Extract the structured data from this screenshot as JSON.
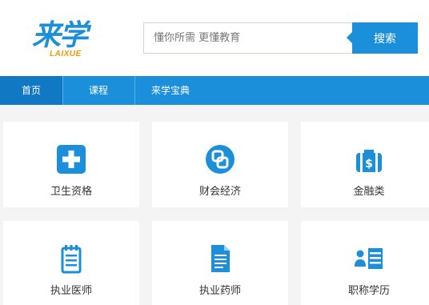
{
  "logo": {
    "main": "来学",
    "sub": "LAIXUE"
  },
  "search": {
    "placeholder": "懂你所需 更懂教育",
    "value": "",
    "button_label": "搜索"
  },
  "nav": {
    "items": [
      "首页",
      "课程",
      "来学宝典"
    ]
  },
  "categories": [
    {
      "label": "卫生资格",
      "icon": "medical-cross-icon"
    },
    {
      "label": "财会经济",
      "icon": "coins-icon"
    },
    {
      "label": "金融类",
      "icon": "money-bag-icon"
    },
    {
      "label": "执业医师",
      "icon": "notepad-icon"
    },
    {
      "label": "执业药师",
      "icon": "document-icon"
    },
    {
      "label": "职称学历",
      "icon": "id-card-icon"
    }
  ],
  "colors": {
    "brand": "#1b8fd9",
    "brand_dark": "#1179c4",
    "accent": "#f39800",
    "background": "#f4f4f4"
  }
}
